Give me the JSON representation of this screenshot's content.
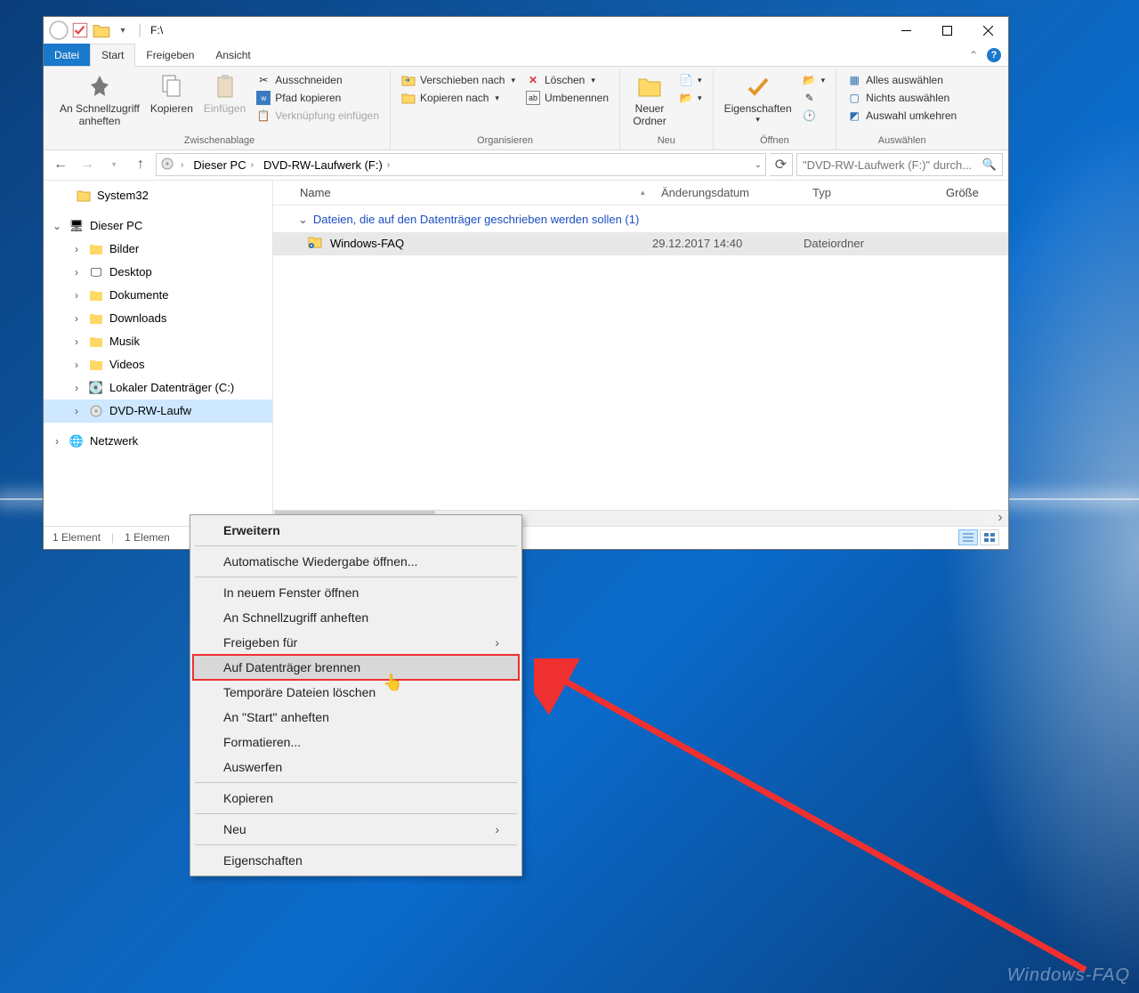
{
  "window": {
    "title": "F:\\",
    "controls": {
      "min": "Minimize",
      "max": "Maximize",
      "close": "Close"
    }
  },
  "tabs": {
    "file": "Datei",
    "start": "Start",
    "freigeben": "Freigeben",
    "ansicht": "Ansicht"
  },
  "ribbon": {
    "clipboard": {
      "pin": "An Schnellzugriff\nanheften",
      "copy": "Kopieren",
      "paste": "Einfügen",
      "cut": "Ausschneiden",
      "copypath": "Pfad kopieren",
      "pastelink": "Verknüpfung einfügen",
      "label": "Zwischenablage"
    },
    "organize": {
      "moveto": "Verschieben nach",
      "copyto": "Kopieren nach",
      "delete": "Löschen",
      "rename": "Umbenennen",
      "label": "Organisieren"
    },
    "new": {
      "folder": "Neuer\nOrdner",
      "label": "Neu"
    },
    "open": {
      "props": "Eigenschaften",
      "label": "Öffnen"
    },
    "select": {
      "all": "Alles auswählen",
      "none": "Nichts auswählen",
      "invert": "Auswahl umkehren",
      "label": "Auswählen"
    }
  },
  "address": {
    "crumbs": [
      "Dieser PC",
      "DVD-RW-Laufwerk (F:)"
    ],
    "search_placeholder": "\"DVD-RW-Laufwerk (F:)\" durch..."
  },
  "tree": {
    "system32": "System32",
    "thispc": "Dieser PC",
    "items": [
      "Bilder",
      "Desktop",
      "Dokumente",
      "Downloads",
      "Musik",
      "Videos",
      "Lokaler Datenträger (C:)",
      "DVD-RW-Laufw"
    ],
    "network": "Netzwerk"
  },
  "list": {
    "headers": {
      "name": "Name",
      "date": "Änderungsdatum",
      "type": "Typ",
      "size": "Größe"
    },
    "group": "Dateien, die auf den Datenträger geschrieben werden sollen (1)",
    "row": {
      "name": "Windows-FAQ",
      "date": "29.12.2017 14:40",
      "type": "Dateiordner"
    }
  },
  "statusbar": {
    "count": "1 Element",
    "sel": "1 Elemen"
  },
  "contextmenu": {
    "expand": "Erweitern",
    "autoplay": "Automatische Wiedergabe öffnen...",
    "newwindow": "In neuem Fenster öffnen",
    "pin": "An Schnellzugriff anheften",
    "share": "Freigeben für",
    "burn": "Auf Datenträger brennen",
    "deltemp": "Temporäre Dateien löschen",
    "pinstart": "An \"Start\" anheften",
    "format": "Formatieren...",
    "eject": "Auswerfen",
    "copy": "Kopieren",
    "new": "Neu",
    "props": "Eigenschaften"
  },
  "watermark": "Windows-FAQ"
}
